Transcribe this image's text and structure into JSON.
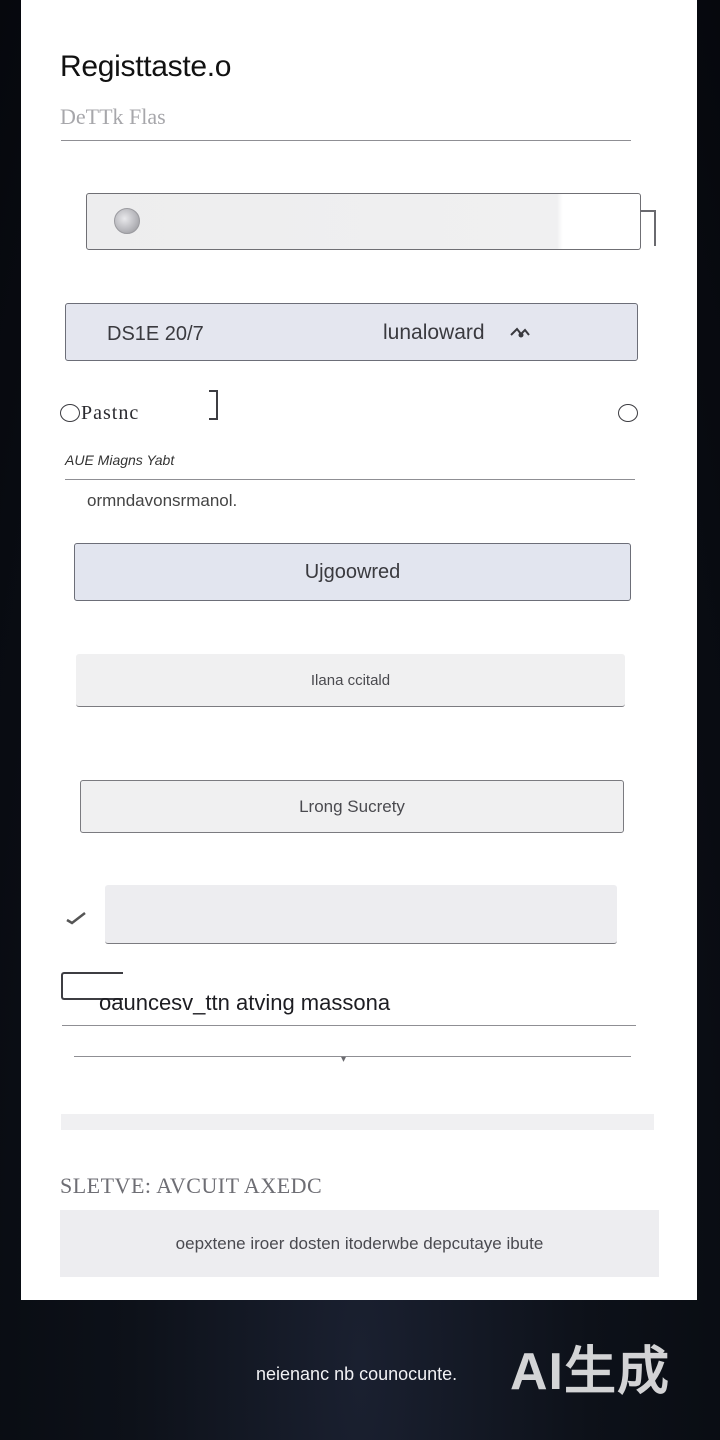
{
  "form": {
    "title": "Registtaste.o",
    "subtitle": "DeTTk Flas",
    "date_bar": {
      "date": "DS1E 20/7",
      "action": "lunaloward"
    },
    "password": {
      "label": "Pastnc"
    },
    "field_label": "AUE Miagns Yabt",
    "helper": "ormndavonsrmanol.",
    "primary_button": "Ujgoowred",
    "secondary_button": "Ilana ccitald",
    "tertiary_button": "Lrong Sucrety",
    "option": "oauncesv_ttn atving massona",
    "section_heading": "SLETVE: AVCUIT AXEDC",
    "notice": "oepxtene iroer dosten itoderwbe depcutaye ibute"
  },
  "footer": {
    "text": "neienanc nb counocunte."
  },
  "watermark": {
    "text": "AI生成"
  },
  "icons": {
    "avatar": "avatar-icon",
    "date_action": "arrow-icon",
    "radio": "radio-icon",
    "check": "check-icon",
    "option": "option-bracket-icon"
  },
  "colors": {
    "accent_fill": "#e2e5ef",
    "card": "#ffffff",
    "background": "#0d1119"
  }
}
